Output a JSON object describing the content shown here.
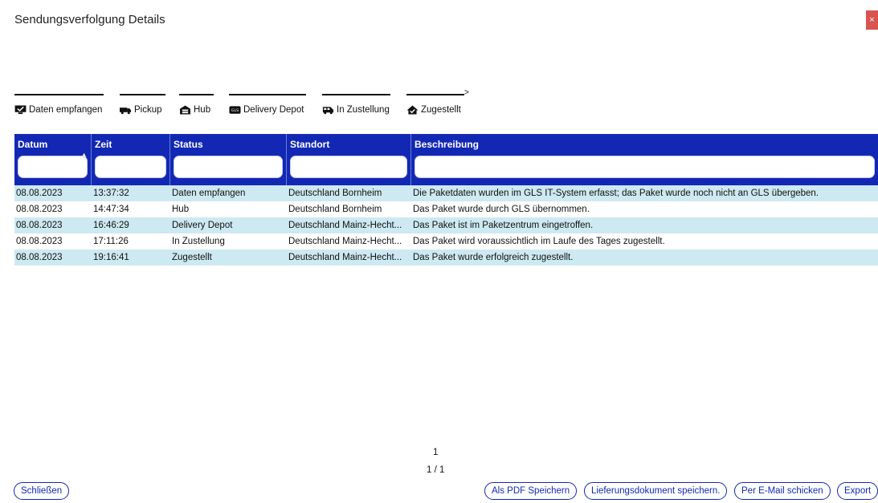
{
  "dialog": {
    "title": "Sendungsverfolgung Details",
    "close_label": "×"
  },
  "steps": [
    {
      "label": "Daten empfangen",
      "icon": "monitor-check-icon"
    },
    {
      "label": "Pickup",
      "icon": "truck-icon"
    },
    {
      "label": "Hub",
      "icon": "warehouse-icon"
    },
    {
      "label": "Delivery Depot",
      "icon": "gls-depot-icon"
    },
    {
      "label": "In Zustellung",
      "icon": "delivery-van-icon"
    },
    {
      "label": "Zugestellt",
      "icon": "house-check-icon"
    }
  ],
  "table": {
    "columns": [
      "Datum",
      "Zeit",
      "Status",
      "Standort",
      "Beschreibung"
    ],
    "rows": [
      [
        "08.08.2023",
        "13:37:32",
        "Daten empfangen",
        "Deutschland Bornheim",
        "Die Paketdaten wurden im GLS IT-System erfasst; das Paket wurde noch nicht an GLS übergeben."
      ],
      [
        "08.08.2023",
        "14:47:34",
        "Hub",
        "Deutschland Bornheim",
        "Das Paket wurde durch GLS übernommen."
      ],
      [
        "08.08.2023",
        "16:46:29",
        "Delivery Depot",
        "Deutschland Mainz-Hecht...",
        "Das Paket ist im Paketzentrum eingetroffen."
      ],
      [
        "08.08.2023",
        "17:11:26",
        "In Zustellung",
        "Deutschland Mainz-Hecht...",
        "Das Paket wird voraussichtlich im Laufe des Tages zugestellt."
      ],
      [
        "08.08.2023",
        "19:16:41",
        "Zugestellt",
        "Deutschland Mainz-Hecht...",
        "Das Paket wurde erfolgreich zugestellt."
      ]
    ]
  },
  "pager": {
    "page": "1",
    "count": "1 / 1"
  },
  "buttons": {
    "close": "Schließen",
    "pdf": "Als PDF Speichern",
    "delivery_doc": "Lieferungsdokument speichern.",
    "email": "Per E-Mail schicken",
    "export": "Export"
  },
  "colors": {
    "header": "#1228b4",
    "row_alt": "#cde9f2",
    "close": "#d9534f"
  }
}
